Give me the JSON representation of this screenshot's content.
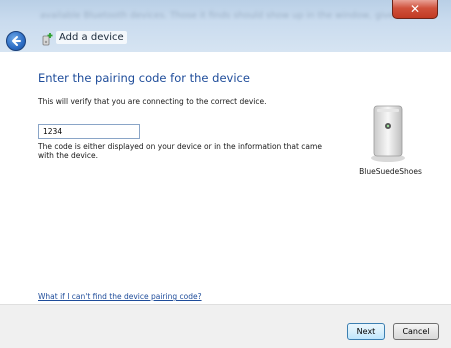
{
  "window": {
    "title": "Add a device",
    "background_text": "available Bluetooth devices. Those it finds should show up in the window, give the device a name in this window. Double-click it to initiate a connection. You'll then",
    "close_glyph": "✕"
  },
  "main": {
    "heading": "Enter the pairing code for the device",
    "description": "This will verify that you are connecting to the correct device.",
    "code_input": {
      "value": "1234",
      "placeholder": ""
    },
    "hint": "The code is either displayed on your device or in the information that came with the device.",
    "device": {
      "name": "BlueSuedeShoes",
      "icon": "device-icon"
    },
    "help_link": "What if I can't find the device pairing code?"
  },
  "footer": {
    "next_label": "Next",
    "cancel_label": "Cancel"
  },
  "colors": {
    "heading": "#1e4c9a",
    "link": "#1e4c9a",
    "close_button": "#c13a23"
  }
}
